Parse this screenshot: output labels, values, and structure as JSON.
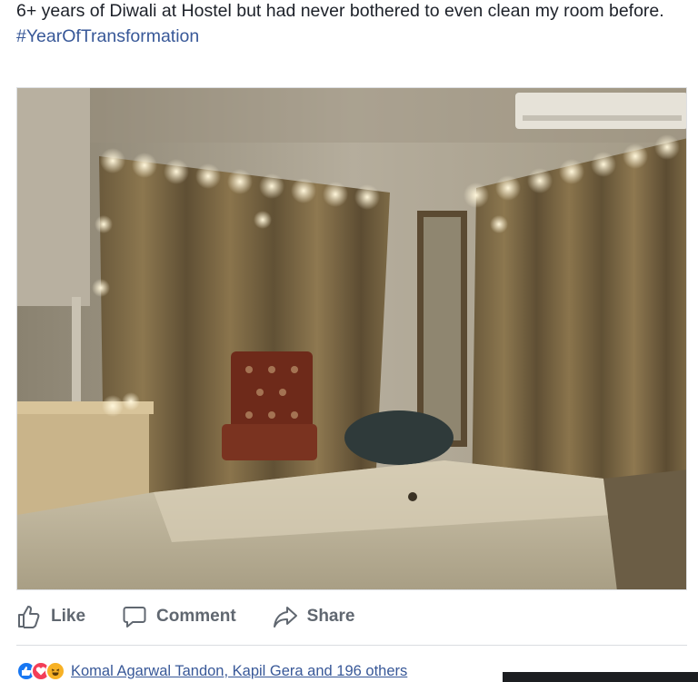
{
  "post": {
    "text": "6+ years of Diwali at Hostel but had never bothered to even clean my room before.",
    "hashtag": "#YearOfTransformation"
  },
  "actions": {
    "like_label": "Like",
    "comment_label": "Comment",
    "share_label": "Share"
  },
  "reactions": {
    "icons": [
      "like-icon",
      "love-icon",
      "haha-icon"
    ],
    "names_text": "Komal Agarwal Tandon, Kapil Gera and 196 others"
  },
  "colors": {
    "link": "#385898",
    "action_text": "#606770",
    "like_blue": "#1877f2",
    "love_red": "#f33e58",
    "haha_yellow": "#f7b125"
  }
}
